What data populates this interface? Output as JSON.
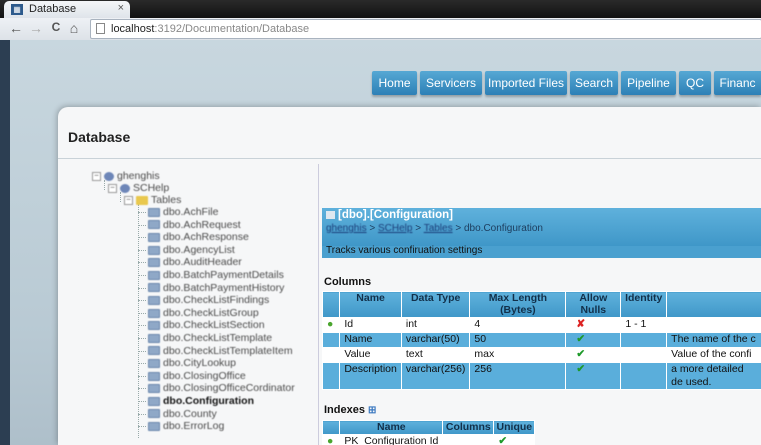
{
  "browser": {
    "tab_title": "Database",
    "tab_close": "×",
    "url_host": "localhost",
    "url_path": ":3192/Documentation/Database"
  },
  "icons": {
    "back": "←",
    "forward": "→",
    "reload": "C",
    "home": "⌂"
  },
  "nav": {
    "items": [
      "Home",
      "Servicers",
      "Imported Files",
      "Search",
      "Pipeline",
      "QC",
      "Financ"
    ]
  },
  "page": {
    "title": "Database"
  },
  "tree": {
    "root": "ghenghis",
    "db": "SCHelp",
    "folder": "Tables",
    "tables": [
      "dbo.AchFile",
      "dbo.AchRequest",
      "dbo.AchResponse",
      "dbo.AgencyList",
      "dbo.AuditHeader",
      "dbo.BatchPaymentDetails",
      "dbo.BatchPaymentHistory",
      "dbo.CheckListFindings",
      "dbo.CheckListGroup",
      "dbo.CheckListSection",
      "dbo.CheckListTemplate",
      "dbo.CheckListTemplateItem",
      "dbo.CityLookup",
      "dbo.ClosingOffice",
      "dbo.ClosingOfficeCordinator",
      "dbo.Configuration",
      "dbo.County",
      "dbo.ErrorLog"
    ],
    "selected": "dbo.Configuration"
  },
  "detail": {
    "title": "[dbo].[Configuration]",
    "crumbs": [
      "ghenghis",
      "SCHelp",
      "Tables",
      "dbo.Configuration"
    ],
    "crumb_sep": " > ",
    "description": "Tracks various confiruation settings",
    "columns_title": "Columns",
    "columns_headers": [
      "Name",
      "Data Type",
      "Max Length (Bytes)",
      "Allow Nulls",
      "Identity",
      ""
    ],
    "columns_rows": [
      {
        "name": "Id",
        "type": "int",
        "length": "4",
        "nulls": "✘",
        "identity": "1 - 1",
        "desc": ""
      },
      {
        "name": "Name",
        "type": "varchar(50)",
        "length": "50",
        "nulls": "✔",
        "identity": "",
        "desc": "The name of the c"
      },
      {
        "name": "Value",
        "type": "text",
        "length": "max",
        "nulls": "✔",
        "identity": "",
        "desc": "Value of the confi"
      },
      {
        "name": "Description",
        "type": "varchar(256)",
        "length": "256",
        "nulls": "✔",
        "identity": "",
        "desc": "a more detailed de used."
      }
    ],
    "indexes_title": "Indexes",
    "indexes_headers": [
      "Name",
      "Columns",
      "Unique"
    ],
    "indexes_rows": [
      {
        "name": "PK_Configuration Id",
        "columns": "",
        "unique": "✔"
      }
    ]
  }
}
